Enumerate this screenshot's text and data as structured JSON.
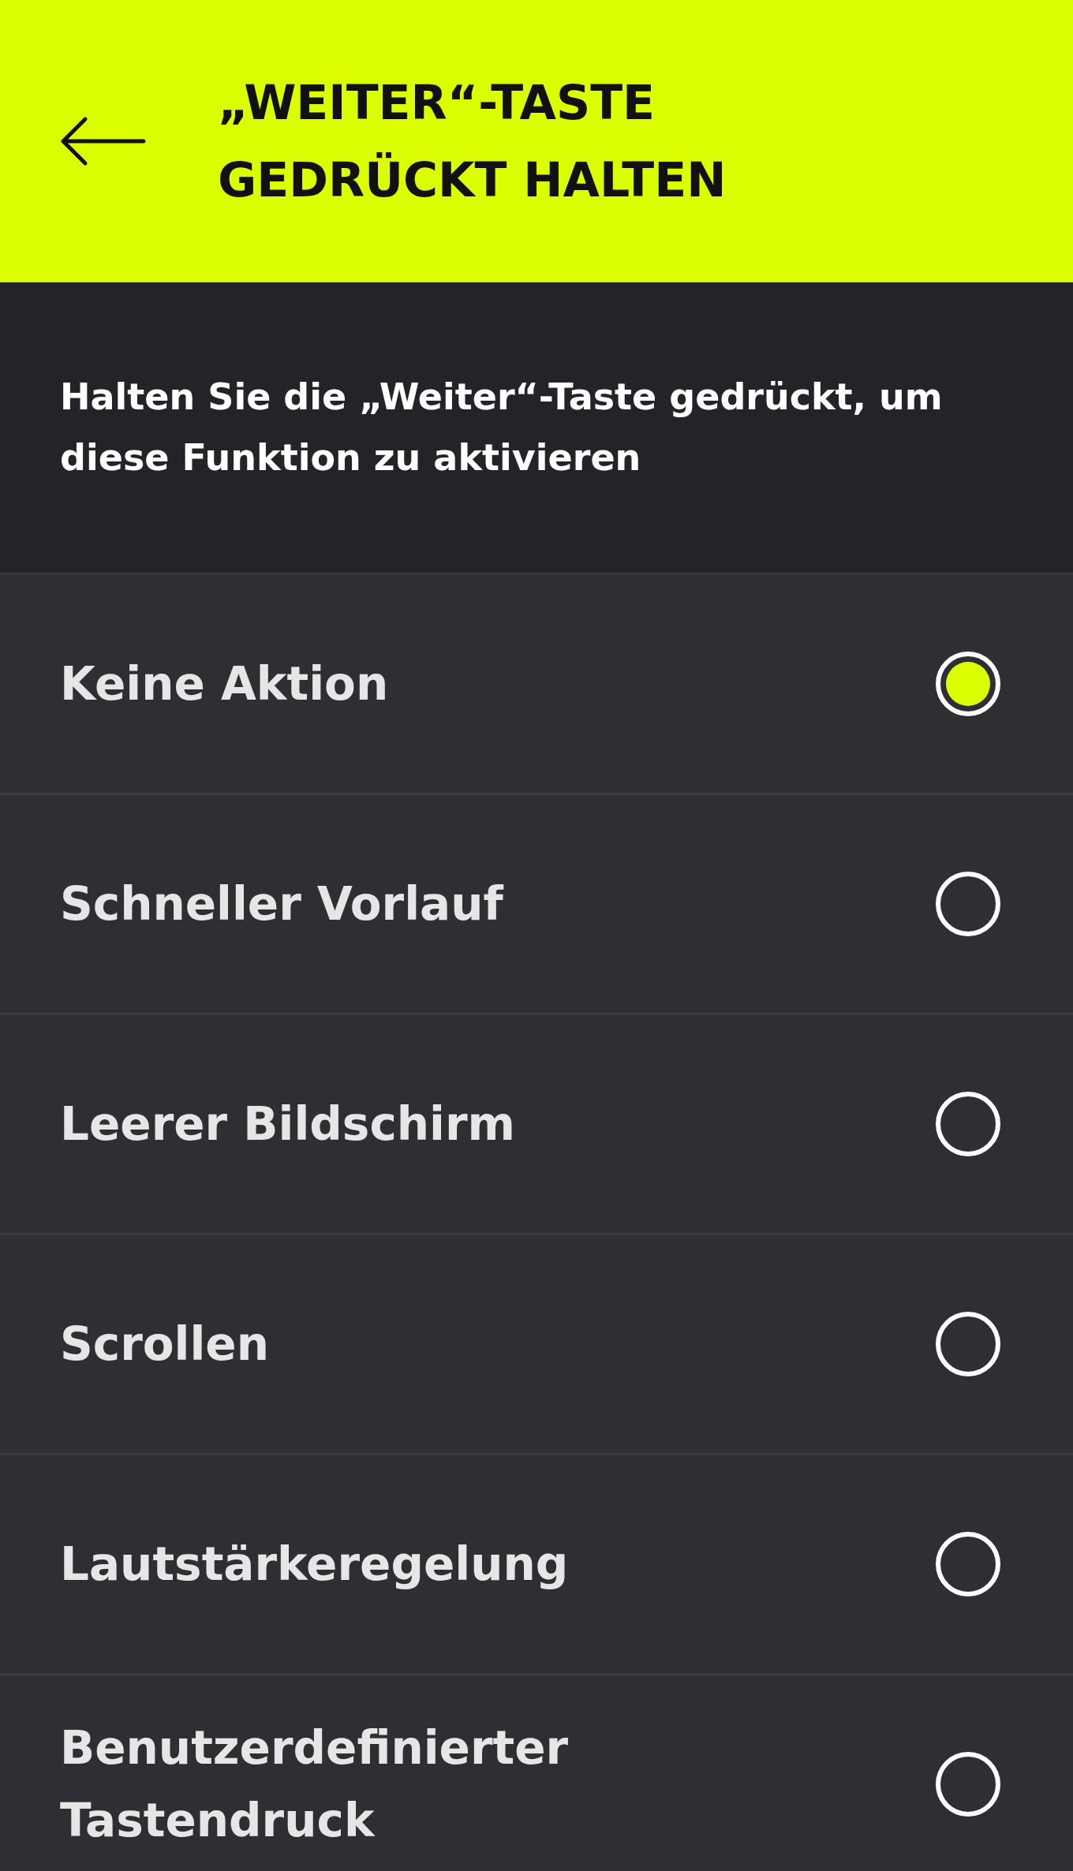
{
  "header": {
    "title": "„WEITER“-TASTE GEDRÜCKT HALTEN"
  },
  "description": "Halten Sie die „Weiter“-Taste gedrückt, um diese Funktion zu aktivieren",
  "options": [
    {
      "label": "Keine Aktion",
      "selected": true
    },
    {
      "label": "Schneller Vorlauf",
      "selected": false
    },
    {
      "label": "Leerer Bildschirm",
      "selected": false
    },
    {
      "label": "Scrollen",
      "selected": false
    },
    {
      "label": "Lautstärkeregelung",
      "selected": false
    },
    {
      "label": "Benutzerdefinierter Tastendruck",
      "selected": false
    }
  ]
}
